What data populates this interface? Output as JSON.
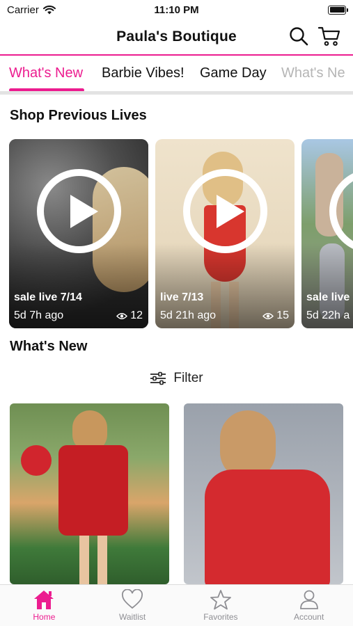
{
  "status_bar": {
    "carrier": "Carrier",
    "time": "11:10 PM"
  },
  "header": {
    "title": "Paula's Boutique",
    "icons": [
      "search-icon",
      "cart-icon"
    ]
  },
  "colors": {
    "accent": "#ec1c8f"
  },
  "tabs": [
    {
      "label": "What's New",
      "active": true
    },
    {
      "label": "Barbie Vibes!"
    },
    {
      "label": "Game Day"
    },
    {
      "label": "What's Ne"
    }
  ],
  "previous_lives": {
    "title": "Shop Previous Lives",
    "items": [
      {
        "title": "sale live 7/14",
        "ago": "5d 7h ago",
        "views": "12"
      },
      {
        "title": "live 7/13",
        "ago": "5d 21h ago",
        "views": "15"
      },
      {
        "title": "sale live",
        "ago": "5d 22h a",
        "views": ""
      }
    ]
  },
  "whats_new": {
    "title": "What's New",
    "filter_label": "Filter"
  },
  "tabbar": [
    {
      "label": "Home",
      "icon": "home-icon",
      "active": true
    },
    {
      "label": "Waitlist",
      "icon": "heart-icon"
    },
    {
      "label": "Favorites",
      "icon": "star-icon"
    },
    {
      "label": "Account",
      "icon": "person-icon"
    }
  ]
}
